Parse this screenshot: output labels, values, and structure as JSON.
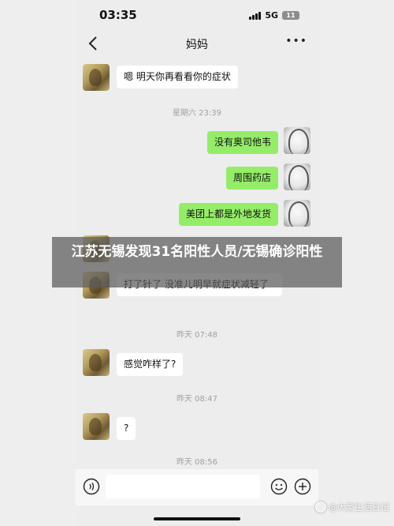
{
  "status_bar": {
    "time": "03:35",
    "network": "5G",
    "battery": "11"
  },
  "header": {
    "title": "妈妈",
    "more": "•••"
  },
  "messages": [
    {
      "sender": "mom",
      "text": "嗯 明天你再看看你的症状"
    },
    {
      "type": "timestamp",
      "text": "星期六 23:39"
    },
    {
      "sender": "me",
      "text": "没有奥司他韦"
    },
    {
      "sender": "me",
      "text": "周围药店"
    },
    {
      "sender": "me",
      "text": "美团上都是外地发货"
    },
    {
      "sender": "mom",
      "text": "打了针了 没准儿明早就症状减轻了"
    },
    {
      "type": "timestamp",
      "text": "昨天 07:48"
    },
    {
      "sender": "mom",
      "text": "感觉咋样了?"
    },
    {
      "type": "timestamp",
      "text": "昨天 08:47"
    },
    {
      "sender": "mom",
      "text": "?"
    },
    {
      "type": "timestamp",
      "text": "昨天 08:56"
    }
  ],
  "overlay": {
    "headline": "江苏无锡发现31名阳性人员/无锡确诊阳性"
  },
  "watermark": {
    "text": "@大蒙生活日记"
  },
  "colors": {
    "sent_bubble": "#95ec69",
    "received_bubble": "#ffffff",
    "background": "#ededed"
  },
  "icons": [
    "back-arrow-icon",
    "more-icon",
    "voice-icon",
    "emoji-icon",
    "plus-icon"
  ]
}
